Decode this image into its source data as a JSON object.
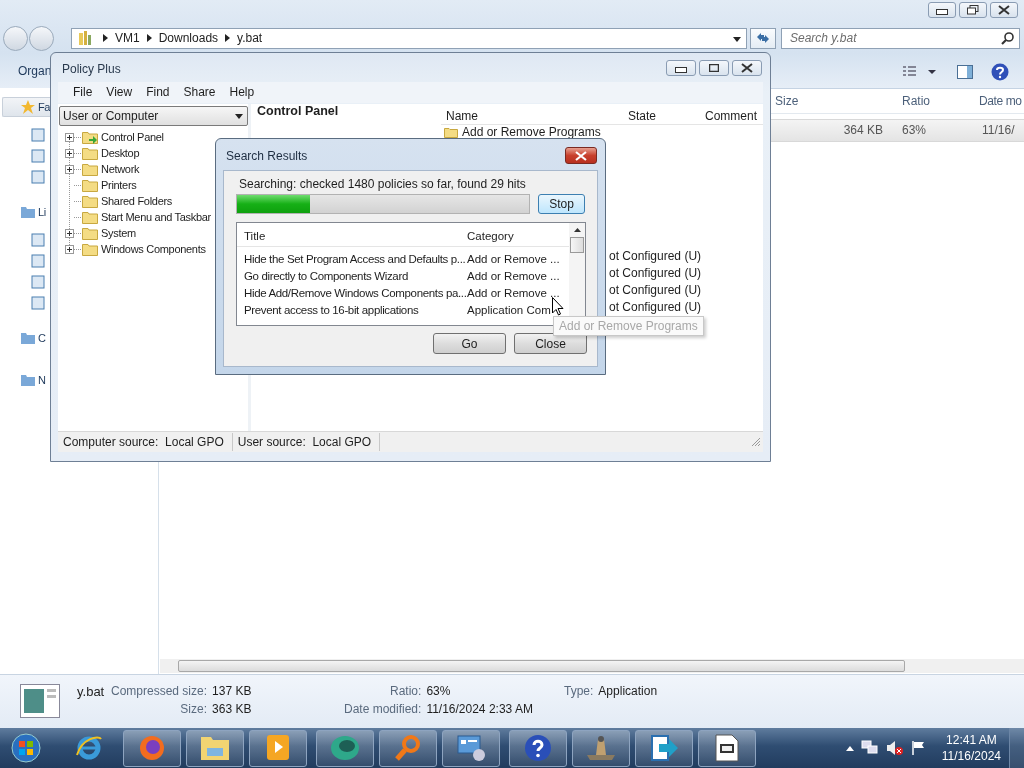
{
  "explorer": {
    "address_path": [
      "VM1",
      "Downloads",
      "y.bat"
    ],
    "search_placeholder": "Search y.bat",
    "toolbar_label": "Organ",
    "nav_items": [
      {
        "label": "Fa",
        "selected": true
      },
      {
        "label": "Li",
        "selected": false
      },
      {
        "label": "C",
        "selected": false
      },
      {
        "label": "N",
        "selected": false
      }
    ],
    "columns": [
      "Size",
      "Ratio",
      "Date mo"
    ],
    "rows": [
      {
        "cells": [
          "364 KB",
          "63%",
          "11/16/"
        ],
        "selected": true
      }
    ],
    "details": {
      "name": "y.bat",
      "fields": [
        {
          "label": "Compressed size:",
          "value": "137 KB"
        },
        {
          "label": "Size:",
          "value": "363 KB"
        },
        {
          "label": "Ratio:",
          "value": "63%"
        },
        {
          "label": "Date modified:",
          "value": "11/16/2024 2:33 AM"
        },
        {
          "label": "Type:",
          "value": "Application"
        }
      ]
    }
  },
  "policy_plus": {
    "title": "Policy Plus",
    "menu": [
      "File",
      "View",
      "Find",
      "Share",
      "Help"
    ],
    "scope": "User or Computer",
    "tree": [
      {
        "label": "Control Panel",
        "expandable": true
      },
      {
        "label": "Desktop",
        "expandable": true
      },
      {
        "label": "Network",
        "expandable": true
      },
      {
        "label": "Printers",
        "expandable": false
      },
      {
        "label": "Shared Folders",
        "expandable": false
      },
      {
        "label": "Start Menu and Taskbar",
        "expandable": false
      },
      {
        "label": "System",
        "expandable": true
      },
      {
        "label": "Windows Components",
        "expandable": true
      }
    ],
    "heading": "Control Panel",
    "columns": [
      "Name",
      "State",
      "Comment"
    ],
    "items": [
      {
        "name": "Add or Remove Programs"
      }
    ],
    "state_cells": [
      "ot Configured (U)",
      "ot Configured (U)",
      "ot Configured (U)",
      "ot Configured (U)"
    ],
    "status": [
      {
        "label": "Computer source:",
        "value": "Local GPO"
      },
      {
        "label": "User source:",
        "value": "Local GPO"
      }
    ]
  },
  "search_results": {
    "title": "Search Results",
    "status": "Searching: checked 1480 policies so far, found 29 hits",
    "progress": {
      "level": 0.25
    },
    "stop": "Stop",
    "columns": [
      "Title",
      "Category"
    ],
    "rows": [
      {
        "title": "Hide the Set Program Access and Defaults p...",
        "category": "Add or Remove ..."
      },
      {
        "title": "Go directly to Components Wizard",
        "category": "Add or Remove ..."
      },
      {
        "title": "Hide Add/Remove Windows Components pa...",
        "category": "Add or Remove ..."
      },
      {
        "title": "Prevent access to 16-bit applications",
        "category": "Application Com"
      }
    ],
    "buttons": [
      "Go",
      "Close"
    ]
  },
  "tooltip": {
    "text": "Add or Remove Programs"
  },
  "taskbar": {
    "time": "12:41 AM",
    "date": "11/16/2024"
  }
}
